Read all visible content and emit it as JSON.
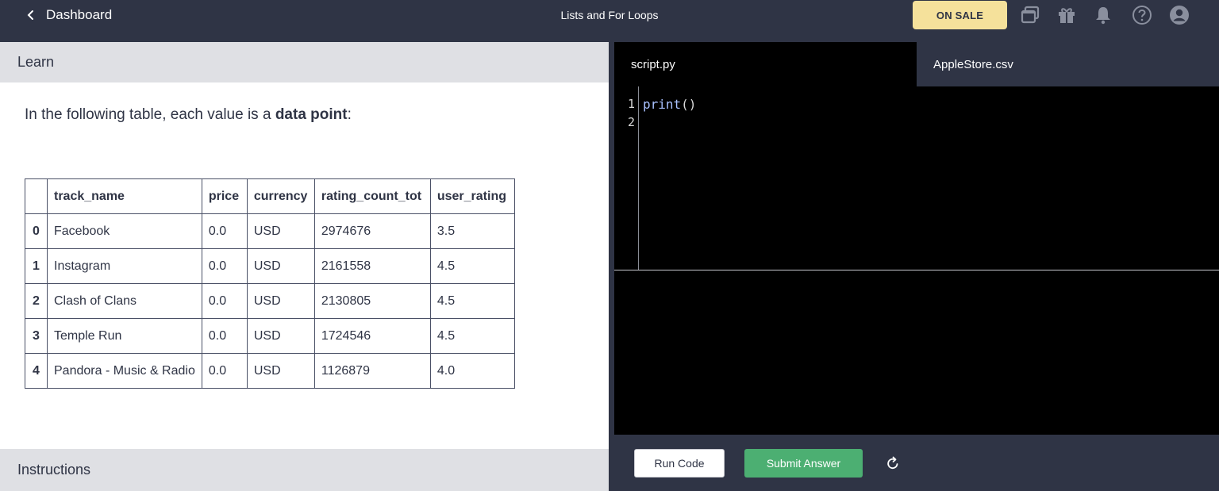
{
  "header": {
    "back_label": "Dashboard",
    "title": "Lists and For Loops",
    "sale_label": "ON SALE"
  },
  "icons": [
    "windows-icon",
    "gift-icon",
    "bell-icon",
    "help-icon",
    "account-icon"
  ],
  "learn": {
    "heading": "Learn",
    "intro_prefix": "In the following table, each value is a ",
    "intro_bold": "data point",
    "intro_suffix": ":",
    "table": {
      "columns": [
        "",
        "track_name",
        "price",
        "currency",
        "rating_count_tot",
        "user_rating"
      ],
      "rows": [
        [
          "0",
          "Facebook",
          "0.0",
          "USD",
          "2974676",
          "3.5"
        ],
        [
          "1",
          "Instagram",
          "0.0",
          "USD",
          "2161558",
          "4.5"
        ],
        [
          "2",
          "Clash of Clans",
          "0.0",
          "USD",
          "2130805",
          "4.5"
        ],
        [
          "3",
          "Temple Run",
          "0.0",
          "USD",
          "1724546",
          "4.5"
        ],
        [
          "4",
          "Pandora - Music & Radio",
          "0.0",
          "USD",
          "1126879",
          "4.0"
        ]
      ]
    }
  },
  "instructions": {
    "heading": "Instructions"
  },
  "editor": {
    "tabs": [
      "script.py",
      "AppleStore.csv"
    ],
    "line_numbers": [
      "1",
      "2"
    ],
    "code_fn": "print",
    "code_args": "()"
  },
  "controls": {
    "run_label": "Run Code",
    "submit_label": "Submit Answer"
  },
  "colors": {
    "navy": "#2f3445",
    "sale": "#f5e19b",
    "submit": "#4caf72",
    "section_bg": "#dfe0e4"
  }
}
